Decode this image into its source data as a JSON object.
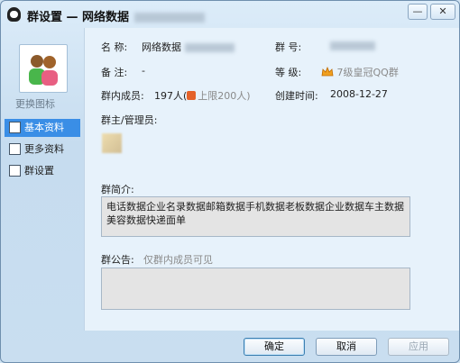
{
  "window": {
    "title": "群设置 — 网络数据"
  },
  "sidebar": {
    "change_icon": "更换图标",
    "items": [
      {
        "label": "基本资料",
        "icon": "basic-info-icon",
        "active": true
      },
      {
        "label": "更多资料",
        "icon": "more-info-icon",
        "active": false
      },
      {
        "label": "群设置",
        "icon": "group-settings-icon",
        "active": false
      }
    ]
  },
  "info": {
    "name_label": "名  称:",
    "name_value": "网络数据",
    "number_label": "群    号:",
    "note_label": "备  注:",
    "note_value": "-",
    "level_label": "等    级:",
    "level_value": "7级皇冠QQ群",
    "members_label": "群内成员:",
    "members_value": "197人(",
    "members_limit": "上限200人)",
    "created_label": "创建时间:",
    "created_value": "2008-12-27",
    "admins_label": "群主/管理员:"
  },
  "intro": {
    "label": "群简介:",
    "text": "电话数据企业名录数据邮箱数据手机数据老板数据企业数据车主数据美容数据快递面单"
  },
  "notice": {
    "label": "群公告:",
    "hint": "仅群内成员可见",
    "text": ""
  },
  "buttons": {
    "ok": "确定",
    "cancel": "取消",
    "apply": "应用"
  }
}
